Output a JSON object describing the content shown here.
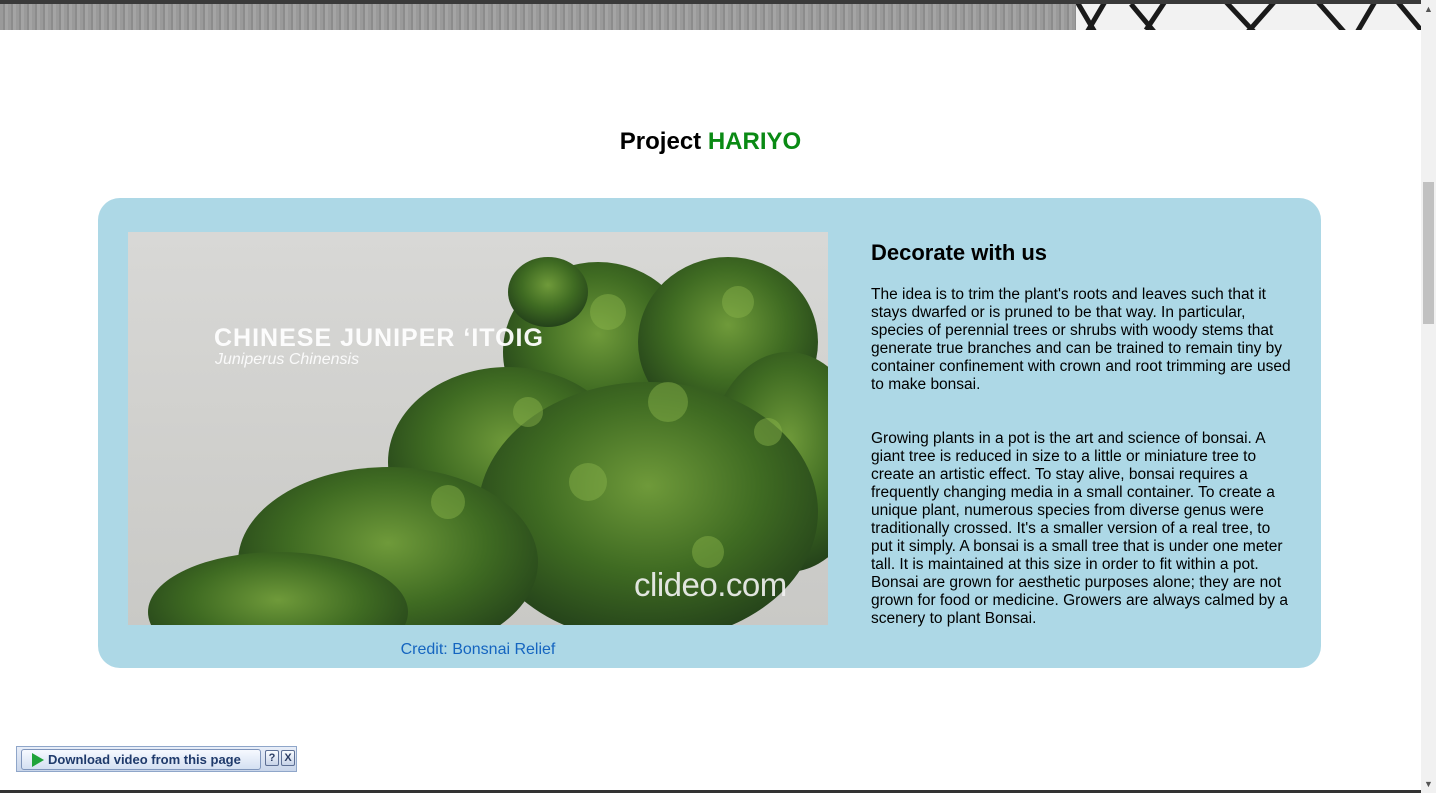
{
  "header": {
    "title_prefix": "Project",
    "title_accent": "HARIYO"
  },
  "feature": {
    "video": {
      "overlay_title": "CHINESE JUNIPER ‘ITOIG",
      "overlay_subtitle": "Juniperus Chinensis",
      "watermark": "clideo.com"
    },
    "credit_link": "Credit: Bonsnai Relief",
    "heading": "Decorate with us",
    "paragraph_1": "The idea is to trim the plant's roots and leaves such that it stays dwarfed or is pruned to be that way. In particular, species of perennial trees or shrubs with woody stems that generate true branches and can be trained to remain tiny by container confinement with crown and root trimming are used to make bonsai.",
    "paragraph_2": "Growing plants in a pot is the art and science of bonsai. A giant tree is reduced in size to a little or miniature tree to create an artistic effect. To stay alive, bonsai requires a frequently changing media in a small container. To create a unique plant, numerous species from diverse genus were traditionally crossed. It's a smaller version of a real tree, to put it simply. A bonsai is a small tree that is under one meter tall. It is maintained at this size in order to fit within a pot. Bonsai are grown for aesthetic purposes alone; they are not grown for food or medicine. Growers are always calmed by a scenery to plant Bonsai."
  },
  "download_toolbar": {
    "button_label": "Download video from this page",
    "help_label": "?",
    "close_label": "X"
  },
  "colors": {
    "accent_green": "#0a8a14",
    "card_background": "#add8e6",
    "link_blue": "#1565c0"
  }
}
